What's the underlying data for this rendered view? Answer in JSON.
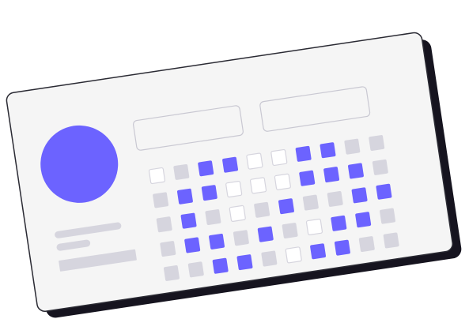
{
  "colors": {
    "shadow": "#16141f",
    "card_fill": "#f5f5f5",
    "card_border": "#2a2a33",
    "accent": "#6c63ff",
    "placeholder_gray": "#d6d5de",
    "empty_cell_fill": "#ffffff",
    "empty_cell_border": "#d6d5de",
    "input_border": "#c9c8d2"
  },
  "profile": {
    "avatar_icon": "avatar-circle",
    "text_lines": 3
  },
  "inputs": [
    {
      "name": "input-placeholder-1",
      "value": "",
      "placeholder": ""
    },
    {
      "name": "input-placeholder-2",
      "value": "",
      "placeholder": ""
    }
  ],
  "grid": {
    "rows": 5,
    "cols": 10,
    "cell_states": [
      [
        "empty",
        "gray",
        "accent",
        "accent",
        "empty",
        "empty",
        "accent",
        "accent",
        "gray",
        "gray"
      ],
      [
        "gray",
        "accent",
        "accent",
        "empty",
        "empty",
        "empty",
        "accent",
        "accent",
        "accent",
        "gray"
      ],
      [
        "gray",
        "accent",
        "gray",
        "empty",
        "gray",
        "accent",
        "gray",
        "gray",
        "accent",
        "accent"
      ],
      [
        "gray",
        "accent",
        "accent",
        "gray",
        "accent",
        "gray",
        "empty",
        "accent",
        "accent",
        "gray"
      ],
      [
        "gray",
        "gray",
        "accent",
        "accent",
        "gray",
        "empty",
        "accent",
        "accent",
        "gray",
        "gray"
      ]
    ]
  }
}
